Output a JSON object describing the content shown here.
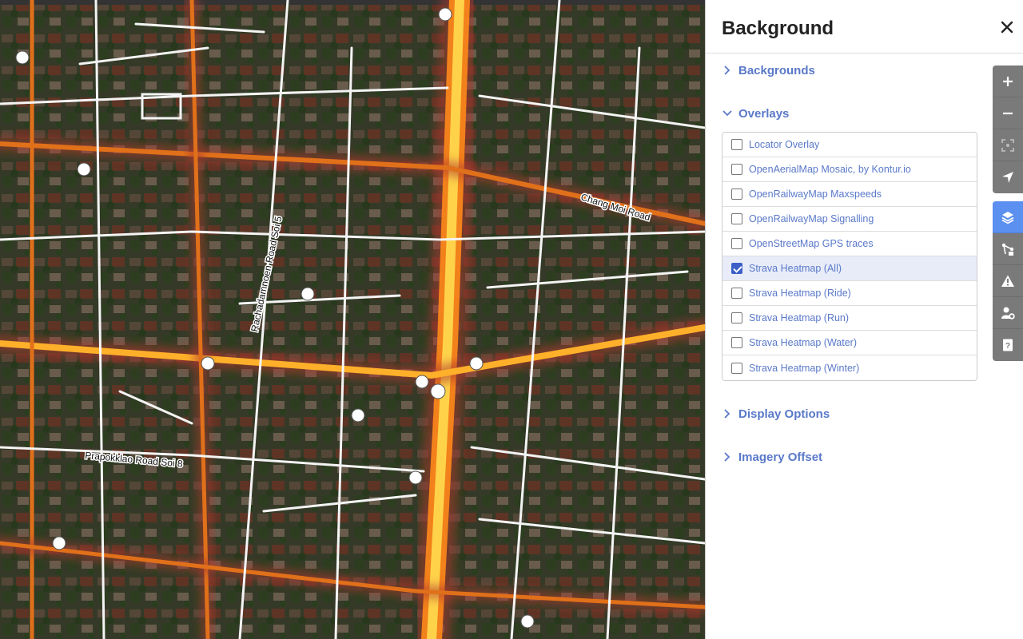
{
  "pane": {
    "title": "Background",
    "sections": {
      "backgrounds": "Backgrounds",
      "overlays": "Overlays",
      "display_options": "Display Options",
      "imagery_offset": "Imagery Offset"
    },
    "overlays": [
      {
        "label": "Locator Overlay",
        "checked": false
      },
      {
        "label": "OpenAerialMap Mosaic, by Kontur.io",
        "checked": false
      },
      {
        "label": "OpenRailwayMap Maxspeeds",
        "checked": false
      },
      {
        "label": "OpenRailwayMap Signalling",
        "checked": false
      },
      {
        "label": "OpenStreetMap GPS traces",
        "checked": false
      },
      {
        "label": "Strava Heatmap (All)",
        "checked": true
      },
      {
        "label": "Strava Heatmap (Ride)",
        "checked": false
      },
      {
        "label": "Strava Heatmap (Run)",
        "checked": false
      },
      {
        "label": "Strava Heatmap (Water)",
        "checked": false
      },
      {
        "label": "Strava Heatmap (Winter)",
        "checked": false
      }
    ]
  },
  "map": {
    "street_labels": [
      "Chang Moi Road",
      "Rachadamnoen Road Soi 5",
      "Prapokklao Road Soi 8"
    ]
  },
  "controls": {
    "group1": [
      "zoom-in-icon",
      "zoom-out-icon",
      "zoom-to-selection-icon",
      "geolocate-icon"
    ],
    "group2": [
      "layers-icon",
      "map-data-icon",
      "issues-icon",
      "preferences-icon",
      "help-icon"
    ]
  },
  "colors": {
    "accent": "#5a79c9",
    "active_control": "#5b8ff0",
    "control_bg": "#7a7a7a",
    "heatmap_core": "#ffd24a",
    "heatmap_glow": "#b03a2e"
  }
}
